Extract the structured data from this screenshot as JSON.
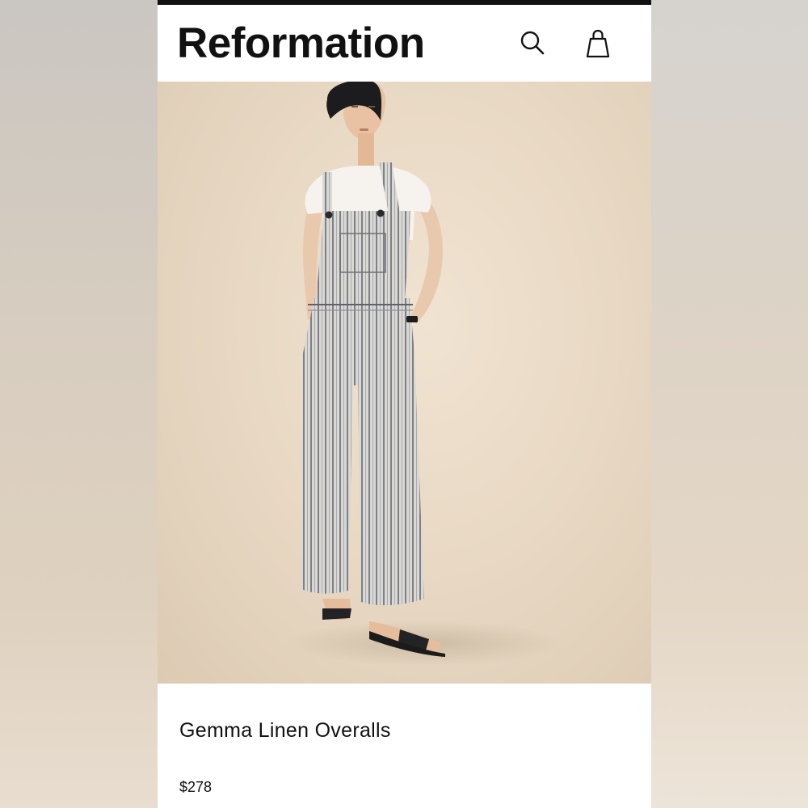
{
  "brand": {
    "name": "Reformation"
  },
  "header": {
    "icons": [
      "search-icon",
      "shopping-bag-icon"
    ]
  },
  "product": {
    "image_alt": "Model wearing striped linen overalls with white tee and black sandals",
    "name": "Gemma Linen Overalls",
    "price": "$278"
  },
  "colors": {
    "header_bg": "#ffffff",
    "top_bar": "#111111",
    "text": "#111111",
    "image_bg": "#e7d7c2"
  }
}
